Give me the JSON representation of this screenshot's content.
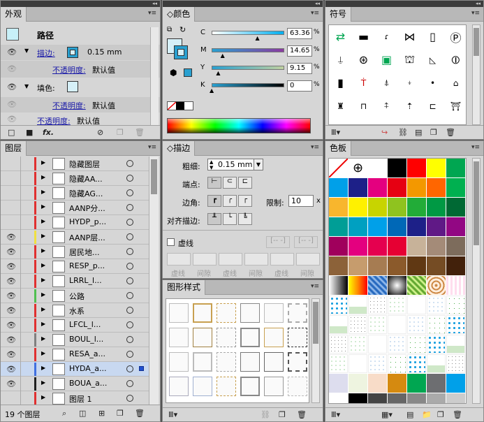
{
  "appearance": {
    "tab": "外观",
    "header": "路径",
    "stroke_label": "描边:",
    "stroke_value": "0.15 mm",
    "opacity_label": "不透明度:",
    "opacity_value": "默认值",
    "fill_label": "填色:",
    "opacity2_label": "不透明度:",
    "opacity2_value": "默认值",
    "opacity3_label": "不透明度:",
    "opacity3_value": "默认值",
    "fx": "fx."
  },
  "color": {
    "tab": "颜色",
    "C_label": "C",
    "C_value": "63.36",
    "M_label": "M",
    "M_value": "14.65",
    "Y_label": "Y",
    "Y_value": "9.15",
    "K_label": "K",
    "K_value": "0",
    "pct": "%",
    "levels": {
      "C": 0.63,
      "M": 0.15,
      "Y": 0.09,
      "K": 0
    }
  },
  "symbols": {
    "tab": "符号"
  },
  "layers": {
    "tab": "图层",
    "count_text": "19 个图层",
    "items": [
      {
        "name": "隐藏图层",
        "color": "#e03030",
        "eye": false
      },
      {
        "name": "隐藏AA...",
        "color": "#e03030",
        "eye": false
      },
      {
        "name": "隐藏AG...",
        "color": "#e03030",
        "eye": false
      },
      {
        "name": "AANP分...",
        "color": "#e03030",
        "eye": false
      },
      {
        "name": "HYDP_p...",
        "color": "#e03030",
        "eye": false
      },
      {
        "name": "AANP层...",
        "color": "#f0e040",
        "eye": true
      },
      {
        "name": "居民地...",
        "color": "#e03030",
        "eye": true
      },
      {
        "name": "RESP_p...",
        "color": "#e03030",
        "eye": true
      },
      {
        "name": "LRRL_l...",
        "color": "#e03030",
        "eye": true
      },
      {
        "name": "公路",
        "color": "#50c050",
        "eye": true
      },
      {
        "name": "水系",
        "color": "#e03030",
        "eye": true
      },
      {
        "name": "LFCL_l...",
        "color": "#e03030",
        "eye": true
      },
      {
        "name": "BOUL_l...",
        "color": "#808080",
        "eye": true
      },
      {
        "name": "RESA_a...",
        "color": "#e03030",
        "eye": true
      },
      {
        "name": "HYDA_a...",
        "color": "#4070e0",
        "eye": true
      },
      {
        "name": "BOUA_a...",
        "color": "#202020",
        "eye": true
      },
      {
        "name": "图层 1",
        "color": "#e03030",
        "eye": false
      }
    ]
  },
  "stroke": {
    "tab": "描边",
    "weight_label": "粗细:",
    "weight_value": "0.15 mm",
    "cap_label": "端点:",
    "corner_label": "边角:",
    "limit_label": "限制:",
    "limit_value": "10",
    "limit_unit": "x",
    "align_label": "对齐描边:",
    "dashed_label": "虚线",
    "dash_labels": [
      "虚线",
      "间隙",
      "虚线",
      "间隙",
      "虚线",
      "间隙"
    ]
  },
  "graphic_styles": {
    "tab": "图形样式"
  },
  "swatches": {
    "tab": "色板",
    "row1": [
      "#ffffff",
      "#ffffff",
      "#000000",
      "#ff0000",
      "#ffff00",
      "#00a651"
    ],
    "row2": [
      "#00a0e9",
      "#1d2088",
      "#e4007f",
      "#e60012",
      "#f39800",
      "#ff6600",
      "#00b050"
    ],
    "row3": [
      "#f8b62d",
      "#fff100",
      "#c8d400",
      "#8fc31f",
      "#22ac38",
      "#009944",
      "#006934"
    ],
    "row4": [
      "#009e96",
      "#00a0c1",
      "#00a0e9",
      "#0068b7",
      "#1d2088",
      "#601986",
      "#920783"
    ],
    "row5": [
      "#a0005c",
      "#e4007f",
      "#e5004f",
      "#e60033",
      "#c7b299",
      "#a48b78",
      "#7d6c5c"
    ],
    "row6": [
      "#8c6239",
      "#c69c6d",
      "#a67c52",
      "#8b5a2b",
      "#603813",
      "#754c24",
      "#42210b"
    ]
  }
}
